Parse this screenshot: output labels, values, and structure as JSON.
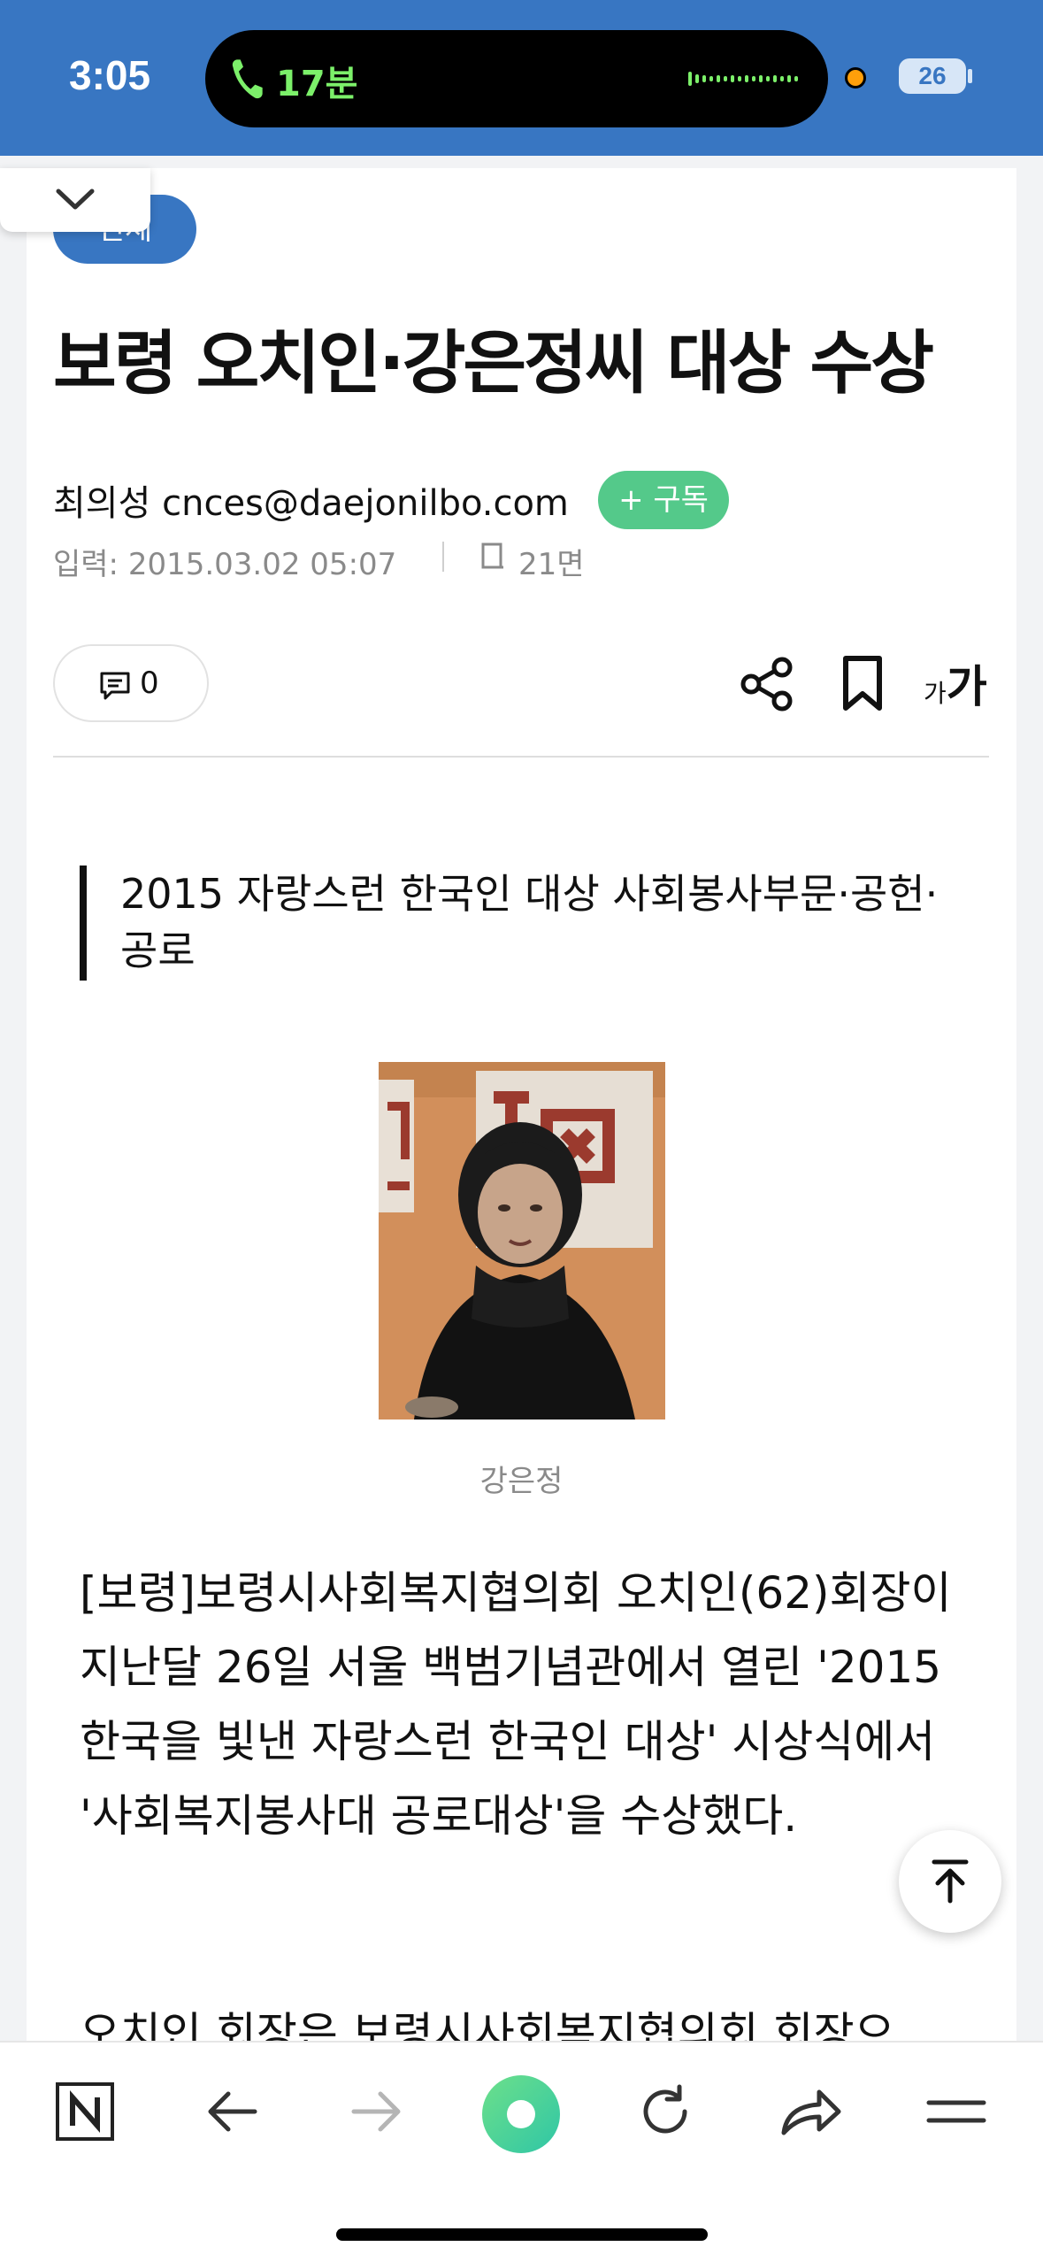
{
  "status_bar": {
    "time": "3:05",
    "call_duration": "17분",
    "battery": "26"
  },
  "article": {
    "category": "전체",
    "headline": "보령 오치인·강은정씨 대상 수상",
    "reporter": "최의성 cnces@daejonilbo.com",
    "subscribe_label": "+ 구독",
    "input_date": "입력: 2015.03.02 05:07",
    "page": "21면",
    "comment_count": "0",
    "font_size_small": "가",
    "font_size_big": "가",
    "subtitle": "2015 자랑스런 한국인 대상 사회봉사부문·공헌·공로",
    "photo_caption": "강은정",
    "body_paragraph_1": "[보령]보령시사회복지협의회 오치인(62)회장이 지난달 26일 서울 백범기념관에서 열린 '2015 한국을 빛낸 자랑스런 한국인 대상' 시상식에서 '사회복지봉사대 공로대상'을 수상했다.",
    "body_paragraph_2": "오치인 회장은 보령시사회복지협의회 회장으"
  },
  "icons": {
    "collapse": "chevron-down-icon",
    "comment": "comment-icon",
    "share": "share-icon",
    "bookmark": "bookmark-icon",
    "scroll_top": "arrow-up-icon",
    "toolbar": [
      "naver-n-icon",
      "back-arrow-icon",
      "forward-arrow-icon",
      "green-dot-icon",
      "reload-icon",
      "share-arrow-icon",
      "menu-icon"
    ]
  },
  "colors": {
    "accent": "#3876c2",
    "subscribe": "#54c98a",
    "call_green": "#7cf06a",
    "status_orange": "#ff9f0a"
  }
}
